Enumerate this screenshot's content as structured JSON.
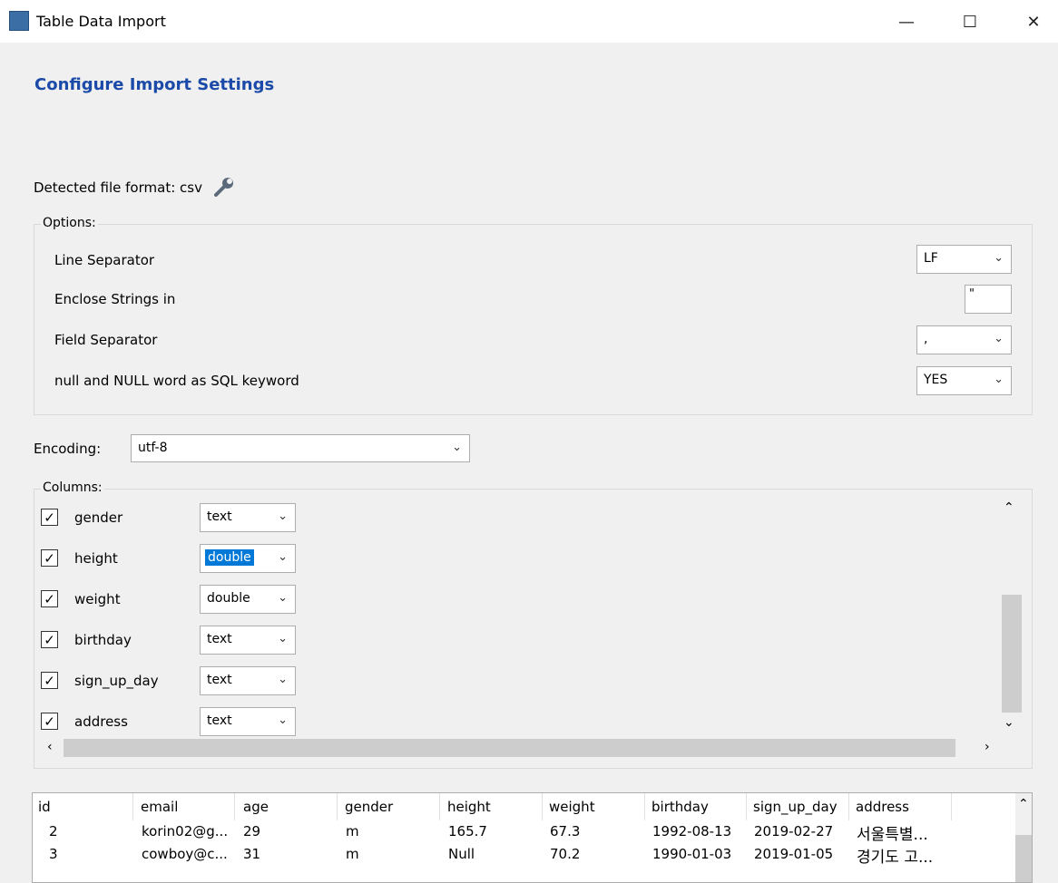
{
  "window": {
    "title": "Table Data Import",
    "controls": {
      "minimize": "—",
      "maximize": "☐",
      "close": "✕"
    }
  },
  "heading": "Configure Import Settings",
  "detected_format": "Detected file format: csv",
  "options": {
    "legend": "Options:",
    "line_separator": {
      "label": "Line Separator",
      "value": "LF"
    },
    "enclose_strings": {
      "label": "Enclose Strings in",
      "value": "\""
    },
    "field_separator": {
      "label": "Field Separator",
      "value": ","
    },
    "null_keyword": {
      "label": "null and NULL word as SQL keyword",
      "value": "YES"
    }
  },
  "encoding": {
    "label": "Encoding:",
    "value": "utf-8"
  },
  "columns": {
    "legend": "Columns:",
    "rows": [
      {
        "name": "gender",
        "type": "text",
        "checked": true
      },
      {
        "name": "height",
        "type": "double",
        "checked": true,
        "selected": true
      },
      {
        "name": "weight",
        "type": "double",
        "checked": true
      },
      {
        "name": "birthday",
        "type": "text",
        "checked": true
      },
      {
        "name": "sign_up_day",
        "type": "text",
        "checked": true
      },
      {
        "name": "address",
        "type": "text",
        "checked": true
      }
    ]
  },
  "preview": {
    "headers": [
      "id",
      "email",
      "age",
      "gender",
      "height",
      "weight",
      "birthday",
      "sign_up_day",
      "address"
    ],
    "rows": [
      [
        "2",
        "korin02@g...",
        "29",
        "m",
        "165.7",
        "67.3",
        "1992-08-13",
        "2019-02-27",
        "서울특별..."
      ],
      [
        "3",
        "cowboy@c...",
        "31",
        "m",
        "Null",
        "70.2",
        "1990-01-03",
        "2019-01-05",
        "경기도 고..."
      ]
    ]
  }
}
